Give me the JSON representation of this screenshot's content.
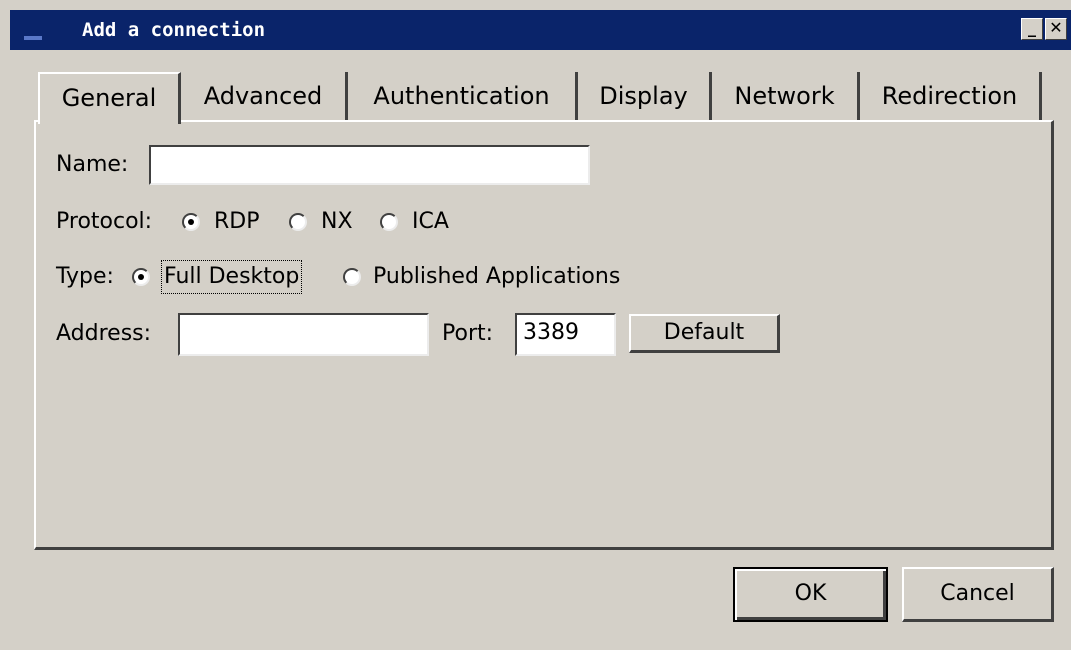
{
  "window": {
    "title": "Add a connection"
  },
  "tabs": [
    {
      "label": "General",
      "active": true
    },
    {
      "label": "Advanced"
    },
    {
      "label": "Authentication"
    },
    {
      "label": "Display"
    },
    {
      "label": "Network"
    },
    {
      "label": "Redirection"
    }
  ],
  "general": {
    "name_label": "Name:",
    "name_value": "",
    "protocol_label": "Protocol:",
    "protocol_options": [
      "RDP",
      "NX",
      "ICA"
    ],
    "protocol_selected": "RDP",
    "type_label": "Type:",
    "type_options": [
      "Full Desktop",
      "Published Applications"
    ],
    "type_selected": "Full Desktop",
    "address_label": "Address:",
    "address_value": "",
    "port_label": "Port:",
    "port_value": "3389",
    "default_button": "Default"
  },
  "buttons": {
    "ok": "OK",
    "cancel": "Cancel"
  },
  "icons": {
    "minimize": "minimize-icon",
    "close": "close-icon",
    "window": "window-icon"
  }
}
